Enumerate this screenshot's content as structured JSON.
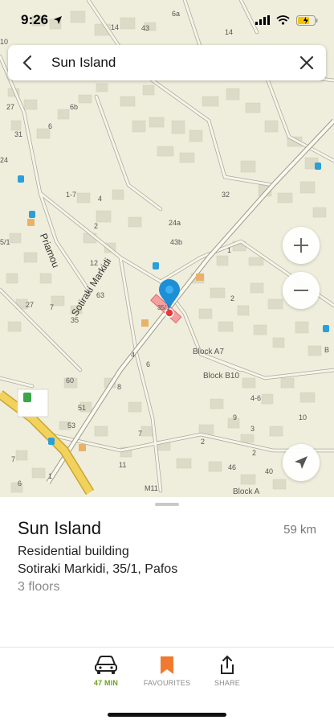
{
  "status_bar": {
    "time": "9:26"
  },
  "search": {
    "query": "Sun Island"
  },
  "map": {
    "labels": {
      "street_1": "Sotiraki Markidi",
      "street_2": "Priamou",
      "block_a7": "Block A7",
      "block_b10": "Block B10",
      "block_a": "Block A",
      "b": "B",
      "n14a": "14",
      "n43": "43",
      "n6a": "6a",
      "n14b": "14",
      "n10": "10",
      "n27a": "27",
      "n6b": "6b",
      "n31": "31",
      "n6": "6",
      "n24": "24",
      "n17": "1-7",
      "n4a": "4",
      "n32": "32",
      "n24a": "24a",
      "n2a": "2",
      "n43b": "43b",
      "n1a": "1",
      "n12": "12",
      "n63": "63",
      "n35_1": "35/1",
      "n2b": "2",
      "n27b": "27",
      "n7a": "7",
      "n35": "35",
      "n4b": "4",
      "n6c": "6",
      "n60": "60",
      "n8": "8",
      "n46a": "4-6",
      "n51": "51",
      "n53": "53",
      "n9": "9",
      "n10b": "10",
      "n3": "3",
      "n7b": "7",
      "n2c": "2",
      "n2d": "2",
      "n11": "11",
      "n46b": "46",
      "n40": "40",
      "n1b": "1",
      "n6d": "6",
      "n7c": "7",
      "m11": "M11",
      "n51b": "5/1"
    }
  },
  "place": {
    "title": "Sun Island",
    "distance": "59 km",
    "category": "Residential building",
    "address": "Sotiraki Markidi, 35/1, Pafos",
    "floors": "3 floors"
  },
  "actions": {
    "route_label": "47 MIN",
    "favourites_label": "FAVOURITES",
    "share_label": "SHARE"
  },
  "colors": {
    "map_bg": "#efeedc",
    "building": "#dcdbc7",
    "road_outline": "#9a9a8c",
    "main_road": "#f2d25a",
    "pin": "#1c8fd6",
    "marker": "#e23b3b",
    "accent_green": "#6aa51b",
    "bookmark_orange": "#f07a30"
  }
}
